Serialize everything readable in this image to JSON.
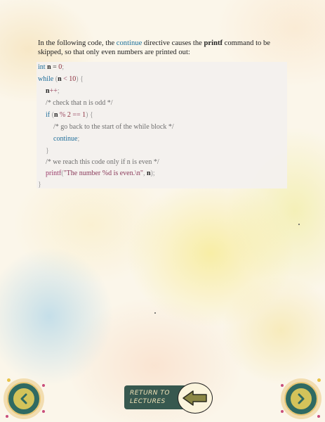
{
  "intro": {
    "before": "In the following code, the ",
    "keyword": "continue",
    "middle": " directive causes the ",
    "command": "printf",
    "after": " command to be skipped, so that only even numbers are printed out:"
  },
  "code": {
    "l1": {
      "type": "int",
      "var": "n",
      "rest": " = ",
      "num": "0",
      "end": ";"
    },
    "l2": {
      "kw": "while",
      "p1": " (",
      "var": "n",
      "op": " < ",
      "num": "10",
      "end": ") {"
    },
    "l3": {
      "var": "n",
      "op": "++",
      "end": ";"
    },
    "l4": {
      "comment": "/* check that n is odd */"
    },
    "l5": {
      "kw": "if",
      "p1": " (",
      "var": "n",
      "op": " % ",
      "num1": "2",
      "op2": " == ",
      "num2": "1",
      "end": ") {"
    },
    "l6": {
      "comment": "/* go back to the start of the while block */"
    },
    "l7": {
      "kw": "continue",
      "end": ";"
    },
    "l8": {
      "brace": "}"
    },
    "l9": {
      "comment": "/* we reach this code only if n is even */"
    },
    "l10": {
      "fn": "printf",
      "p1": "(",
      "str": "\"The number %d is even.\\n\"",
      "sep": ", ",
      "var": "n",
      "end": ");"
    },
    "l11": {
      "brace": "}"
    }
  },
  "nav": {
    "return_line1": "RETURN TO",
    "return_line2": "LECTURES",
    "prev_icon": "chevron-left-icon",
    "next_icon": "chevron-right-icon",
    "return_icon": "arrow-left-icon"
  },
  "colors": {
    "keyword": "#1f6e9a",
    "number": "#8b2d3b",
    "comment": "#6f6f6f",
    "nav_teal": "#2f6a62",
    "nav_gold": "#d3c35a",
    "return_bg": "#37584f",
    "return_text": "#f1e3b8"
  }
}
